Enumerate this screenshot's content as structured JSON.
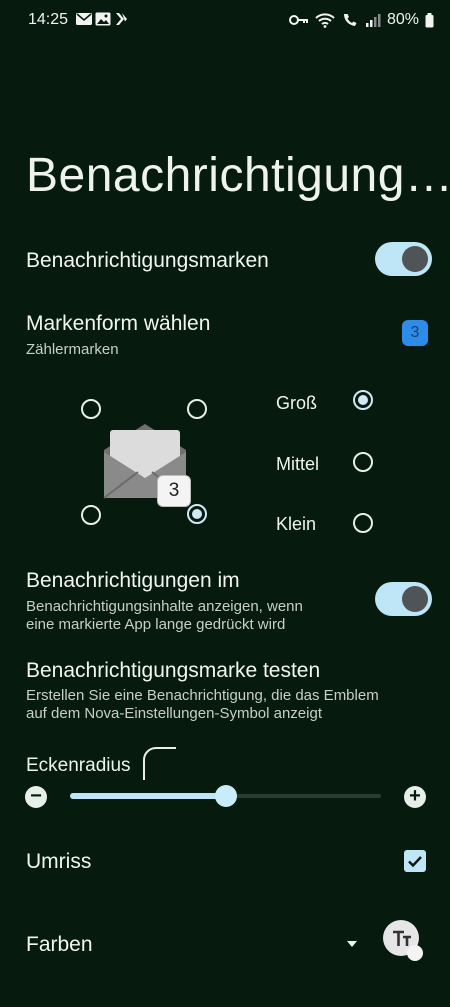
{
  "status_bar": {
    "time": "14:25",
    "battery": "80%"
  },
  "page_title": "Benachrichtigung…",
  "badges_toggle": {
    "label": "Benachrichtigungsmarken"
  },
  "shape": {
    "label": "Markenform wählen",
    "sublabel": "Zählermarken",
    "badge_count": "3"
  },
  "preview": {
    "count": "3"
  },
  "sizes": {
    "large": "Groß",
    "medium": "Mittel",
    "small": "Klein"
  },
  "long_press": {
    "label": "Benachrichtigungen im",
    "sublabel_line1": "Benachrichtigungsinhalte anzeigen, wenn",
    "sublabel_line2": "eine markierte App lange gedrückt wird"
  },
  "test": {
    "label": "Benachrichtigungsmarke testen",
    "sublabel_line1": "Erstellen Sie eine Benachrichtigung, die das Emblem",
    "sublabel_line2": "auf dem Nova-Einstellungen-Symbol anzeigt"
  },
  "corner_radius": {
    "label": "Eckenradius",
    "value_fraction": 0.5,
    "minus": "−",
    "plus": "+"
  },
  "outline": {
    "label": "Umriss"
  },
  "colors": {
    "label": "Farben"
  }
}
